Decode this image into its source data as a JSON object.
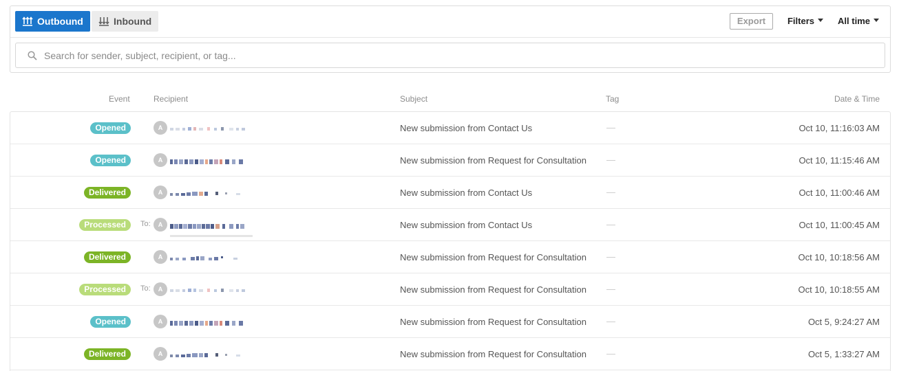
{
  "toolbar": {
    "outbound_label": "Outbound",
    "inbound_label": "Inbound",
    "export_label": "Export",
    "filters_label": "Filters",
    "time_range_label": "All time"
  },
  "search": {
    "placeholder": "Search for sender, subject, recipient, or tag...",
    "value": ""
  },
  "columns": {
    "event": "Event",
    "recipient": "Recipient",
    "subject": "Subject",
    "tag": "Tag",
    "datetime": "Date & Time"
  },
  "colors": {
    "accent": "#1b76cc",
    "opened": "#5bc0c9",
    "delivered": "#7cb426",
    "processed": "#b9dc7a"
  },
  "rows": [
    {
      "event": "Opened",
      "status": "opened",
      "to_label": "",
      "avatar": "A",
      "subject": "New submission from Contact Us",
      "tag": "—",
      "datetime": "Oct 10, 11:16:03 AM"
    },
    {
      "event": "Opened",
      "status": "opened",
      "to_label": "",
      "avatar": "A",
      "subject": "New submission from Request for Consultation",
      "tag": "—",
      "datetime": "Oct 10, 11:15:46 AM"
    },
    {
      "event": "Delivered",
      "status": "delivered",
      "to_label": "",
      "avatar": "A",
      "subject": "New submission from Contact Us",
      "tag": "—",
      "datetime": "Oct 10, 11:00:46 AM"
    },
    {
      "event": "Processed",
      "status": "processed",
      "to_label": "To:",
      "avatar": "A",
      "subject": "New submission from Contact Us",
      "tag": "—",
      "datetime": "Oct 10, 11:00:45 AM"
    },
    {
      "event": "Delivered",
      "status": "delivered",
      "to_label": "",
      "avatar": "A",
      "subject": "New submission from Request for Consultation",
      "tag": "—",
      "datetime": "Oct 10, 10:18:56 AM"
    },
    {
      "event": "Processed",
      "status": "processed",
      "to_label": "To:",
      "avatar": "A",
      "subject": "New submission from Request for Consultation",
      "tag": "—",
      "datetime": "Oct 10, 10:18:55 AM"
    },
    {
      "event": "Opened",
      "status": "opened",
      "to_label": "",
      "avatar": "A",
      "subject": "New submission from Request for Consultation",
      "tag": "—",
      "datetime": "Oct 5, 9:24:27 AM"
    },
    {
      "event": "Delivered",
      "status": "delivered",
      "to_label": "",
      "avatar": "A",
      "subject": "New submission from Request for Consultation",
      "tag": "—",
      "datetime": "Oct 5, 1:33:27 AM"
    }
  ]
}
